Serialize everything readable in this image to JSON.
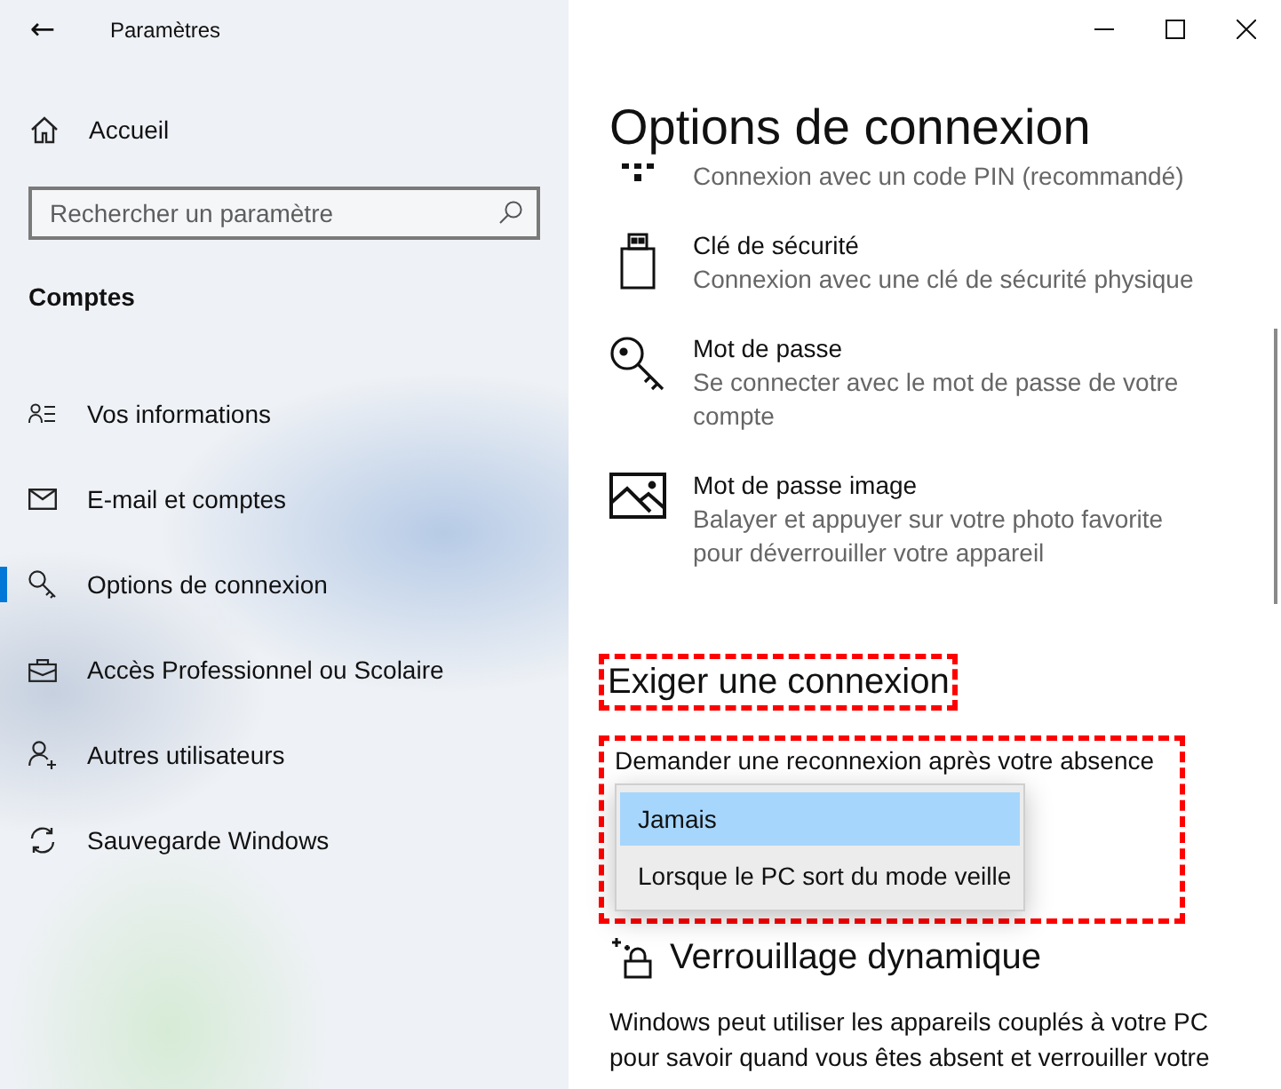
{
  "window": {
    "title": "Paramètres",
    "back": "←"
  },
  "sidebar": {
    "home": "Accueil",
    "search": {
      "placeholder": "Rechercher un paramètre"
    },
    "section": "Comptes",
    "items": [
      {
        "label": "Vos informations",
        "selected": false
      },
      {
        "label": "E-mail et comptes",
        "selected": false
      },
      {
        "label": "Options de connexion",
        "selected": true
      },
      {
        "label": "Accès Professionnel ou Scolaire",
        "selected": false
      },
      {
        "label": "Autres utilisateurs",
        "selected": false
      },
      {
        "label": "Sauvegarde Windows",
        "selected": false
      }
    ]
  },
  "page": {
    "title": "Options de connexion",
    "sign_in_options": [
      {
        "description": "Connexion avec un code PIN (recommandé)"
      },
      {
        "title": "Clé de sécurité",
        "description": "Connexion avec une clé de sécurité physique"
      },
      {
        "title": "Mot de passe",
        "description": "Se connecter avec le mot de passe de votre compte"
      },
      {
        "title": "Mot de passe image",
        "description": "Balayer et appuyer sur votre photo favorite pour déverrouiller votre appareil"
      }
    ],
    "require_sign_in": {
      "heading": "Exiger une connexion",
      "heading_annotated": true,
      "setting_annotated": true,
      "label": "Demander une reconnexion après votre absence",
      "options": [
        {
          "label": "Jamais",
          "selected": true
        },
        {
          "label": "Lorsque le PC sort du mode veille",
          "selected": false
        }
      ]
    },
    "dynamic_lock": {
      "heading": "Verrouillage dynamique",
      "description": "Windows peut utiliser les appareils couplés à votre PC pour savoir quand vous êtes absent et verrouiller votre"
    }
  }
}
